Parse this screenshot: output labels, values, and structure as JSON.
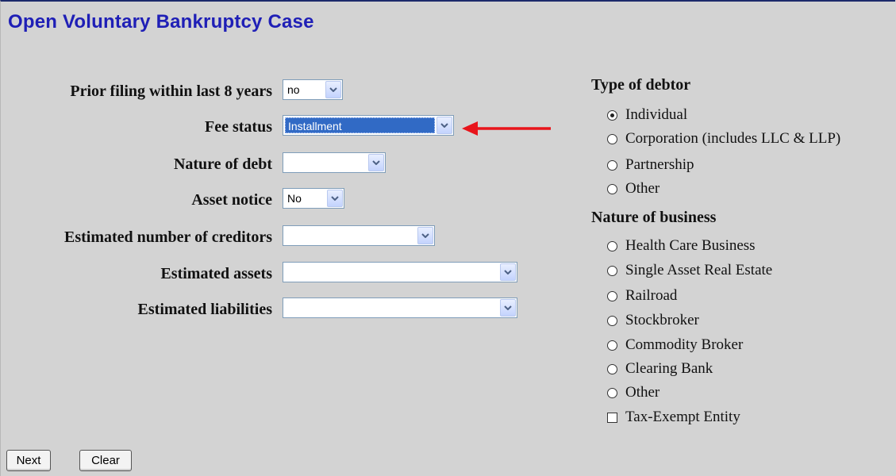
{
  "title": "Open Voluntary Bankruptcy Case",
  "fields": [
    {
      "label": "Prior filing within last 8 years",
      "value": "no"
    },
    {
      "label": "Fee status",
      "value": "Installment"
    },
    {
      "label": "Nature of debt",
      "value": ""
    },
    {
      "label": "Asset notice",
      "value": "No"
    },
    {
      "label": "Estimated number of creditors",
      "value": ""
    },
    {
      "label": "Estimated assets",
      "value": ""
    },
    {
      "label": "Estimated liabilities",
      "value": ""
    }
  ],
  "debtor": {
    "heading": "Type of debtor",
    "options": [
      "Individual",
      "Corporation (includes LLC & LLP)",
      "Partnership",
      "Other"
    ],
    "selected": "Individual"
  },
  "business": {
    "heading": "Nature of business",
    "options": [
      "Health Care Business",
      "Single Asset Real Estate",
      "Railroad",
      "Stockbroker",
      "Commodity Broker",
      "Clearing Bank",
      "Other"
    ],
    "checkbox": "Tax-Exempt Entity"
  },
  "buttons": {
    "next": "Next",
    "clear": "Clear"
  },
  "colors": {
    "annotation_arrow": "#e8141b",
    "title": "#1f1fb6",
    "selection": "#316ac5"
  }
}
